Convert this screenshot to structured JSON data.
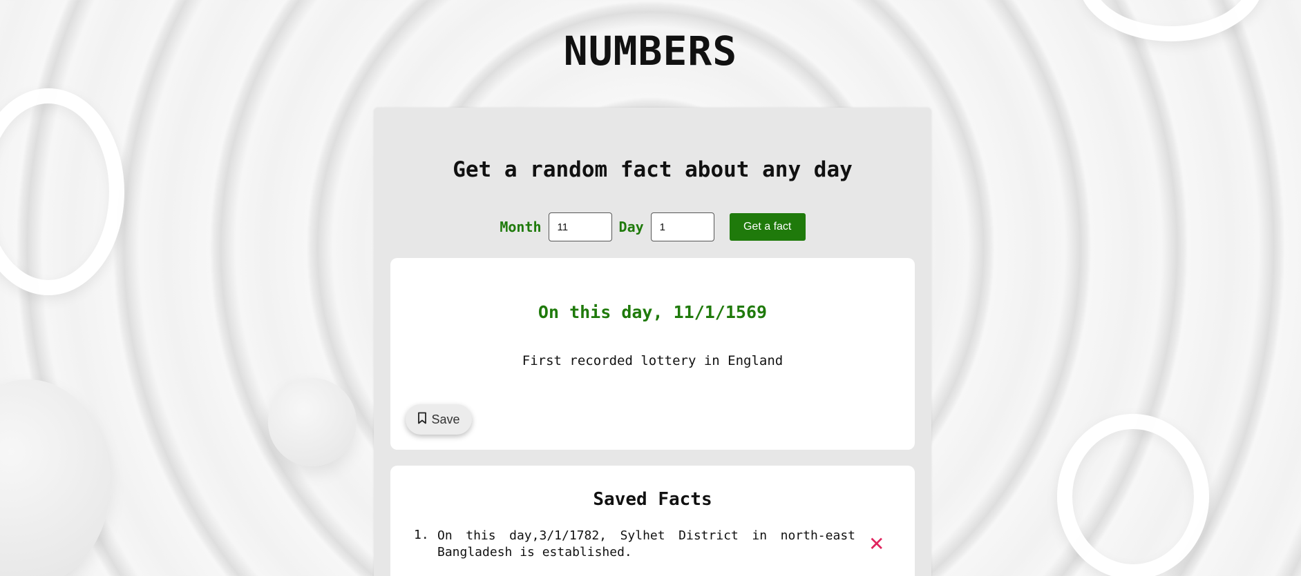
{
  "app": {
    "title": "NUMBERS"
  },
  "main": {
    "subtitle": "Get a random fact about any day",
    "form": {
      "month_label": "Month",
      "month_value": "11",
      "day_label": "Day",
      "day_value": "1",
      "submit_label": "Get a fact"
    },
    "fact": {
      "date_heading": "On this day, 11/1/1569",
      "text": "First recorded lottery in England",
      "save_label": "Save",
      "save_icon": "bookmark-icon"
    },
    "saved": {
      "title": "Saved Facts",
      "items": [
        {
          "number": "1.",
          "text": "On this day,3/1/1782, Sylhet District in north-east Bangladesh is established.",
          "remove_icon": "close-icon"
        }
      ]
    }
  },
  "colors": {
    "accent": "#1f7a0b",
    "remove": "#e0245e",
    "panel": "#e7e7e7",
    "card": "#ffffff"
  }
}
